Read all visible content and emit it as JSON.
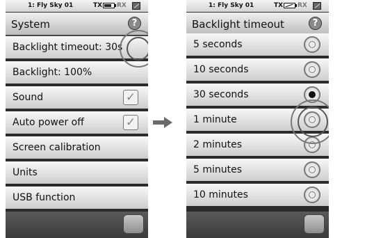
{
  "status": {
    "model": "1: Fly Sky 01",
    "tx": "TX",
    "rx": "RX"
  },
  "left_screen": {
    "title": "System",
    "items": [
      {
        "label": "Backlight timeout: 30s"
      },
      {
        "label": "Backlight: 100%"
      },
      {
        "label": "Sound",
        "checked": true
      },
      {
        "label": "Auto power off",
        "checked": true
      },
      {
        "label": "Screen calibration"
      },
      {
        "label": "Units"
      },
      {
        "label": "USB function"
      }
    ]
  },
  "right_screen": {
    "title": "Backlight timeout",
    "options": [
      {
        "label": "5 seconds",
        "selected": false
      },
      {
        "label": "10 seconds",
        "selected": false
      },
      {
        "label": "30 seconds",
        "selected": true
      },
      {
        "label": "1 minute",
        "selected": false
      },
      {
        "label": "2 minutes",
        "selected": false
      },
      {
        "label": "5 minutes",
        "selected": false
      },
      {
        "label": "10 minutes",
        "selected": false
      }
    ]
  },
  "icons": {
    "help": "help-icon",
    "checkmark": "check-icon",
    "arrow": "arrow-right-icon",
    "back": "back-icon"
  }
}
